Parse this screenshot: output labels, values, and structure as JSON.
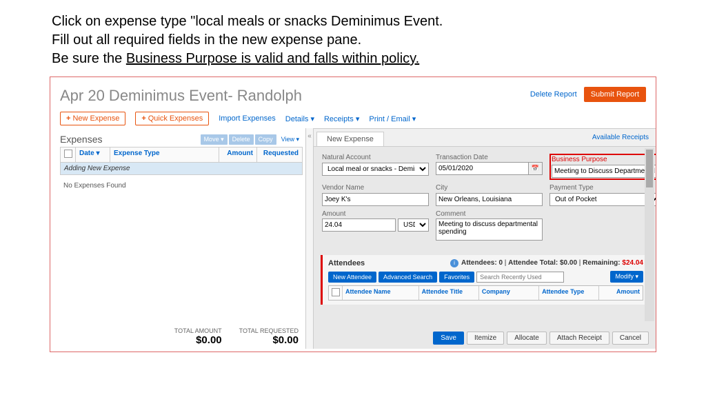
{
  "instructions": {
    "line1a": "Click on expense type \"local meals or snacks Deminimus Event.",
    "line2": "Fill out all required fields in the new expense pane.",
    "line3a": "Be sure the ",
    "line3u": "Business Purpose is valid and falls within policy."
  },
  "report": {
    "title": "Apr 20 Deminimus Event- Randolph",
    "delete": "Delete Report",
    "submit": "Submit Report"
  },
  "toolbar": {
    "newExpense": "New Expense",
    "quickExpenses": "Quick Expenses",
    "import": "Import Expenses",
    "details": "Details ▾",
    "receipts": "Receipts ▾",
    "printEmail": "Print / Email ▾"
  },
  "leftPane": {
    "title": "Expenses",
    "move": "Move ▾",
    "delete": "Delete",
    "copy": "Copy",
    "view": "View ▾",
    "cols": {
      "date": "Date ▾",
      "type": "Expense Type",
      "amount": "Amount",
      "requested": "Requested"
    },
    "adding": "Adding New Expense",
    "noExp": "No Expenses Found",
    "totalAmountLabel": "TOTAL AMOUNT",
    "totalAmount": "$0.00",
    "totalRequestedLabel": "TOTAL REQUESTED",
    "totalRequested": "$0.00"
  },
  "rightPane": {
    "tab": "New Expense",
    "availReceipts": "Available Receipts",
    "fields": {
      "naturalAccount": {
        "label": "Natural Account",
        "value": "Local meal or snacks - Demir"
      },
      "transDate": {
        "label": "Transaction Date",
        "value": "05/01/2020"
      },
      "bizPurpose": {
        "label": "Business Purpose",
        "value": "Meeting to Discuss Departmental Sp"
      },
      "vendor": {
        "label": "Vendor Name",
        "value": "Joey K's"
      },
      "city": {
        "label": "City",
        "value": "New Orleans, Louisiana"
      },
      "payment": {
        "label": "Payment Type",
        "value": "Out of Pocket"
      },
      "amount": {
        "label": "Amount",
        "value": "24.04",
        "unit": "USD"
      },
      "comment": {
        "label": "Comment",
        "value": "Meeting to discuss departmental spending"
      }
    },
    "attendees": {
      "title": "Attendees",
      "count": "Attendees: 0",
      "total": "Attendee Total: $0.00",
      "remainingLabel": "Remaining:",
      "remaining": "$24.04",
      "newAttendee": "New Attendee",
      "advSearch": "Advanced Search",
      "favorites": "Favorites",
      "searchPlaceholder": "Search Recently Used",
      "modify": "Modify ▾",
      "cols": {
        "name": "Attendee Name",
        "title": "Attendee Title",
        "company": "Company",
        "type": "Attendee Type",
        "amount": "Amount"
      }
    },
    "footer": {
      "save": "Save",
      "itemize": "Itemize",
      "allocate": "Allocate",
      "attach": "Attach Receipt",
      "cancel": "Cancel"
    }
  }
}
